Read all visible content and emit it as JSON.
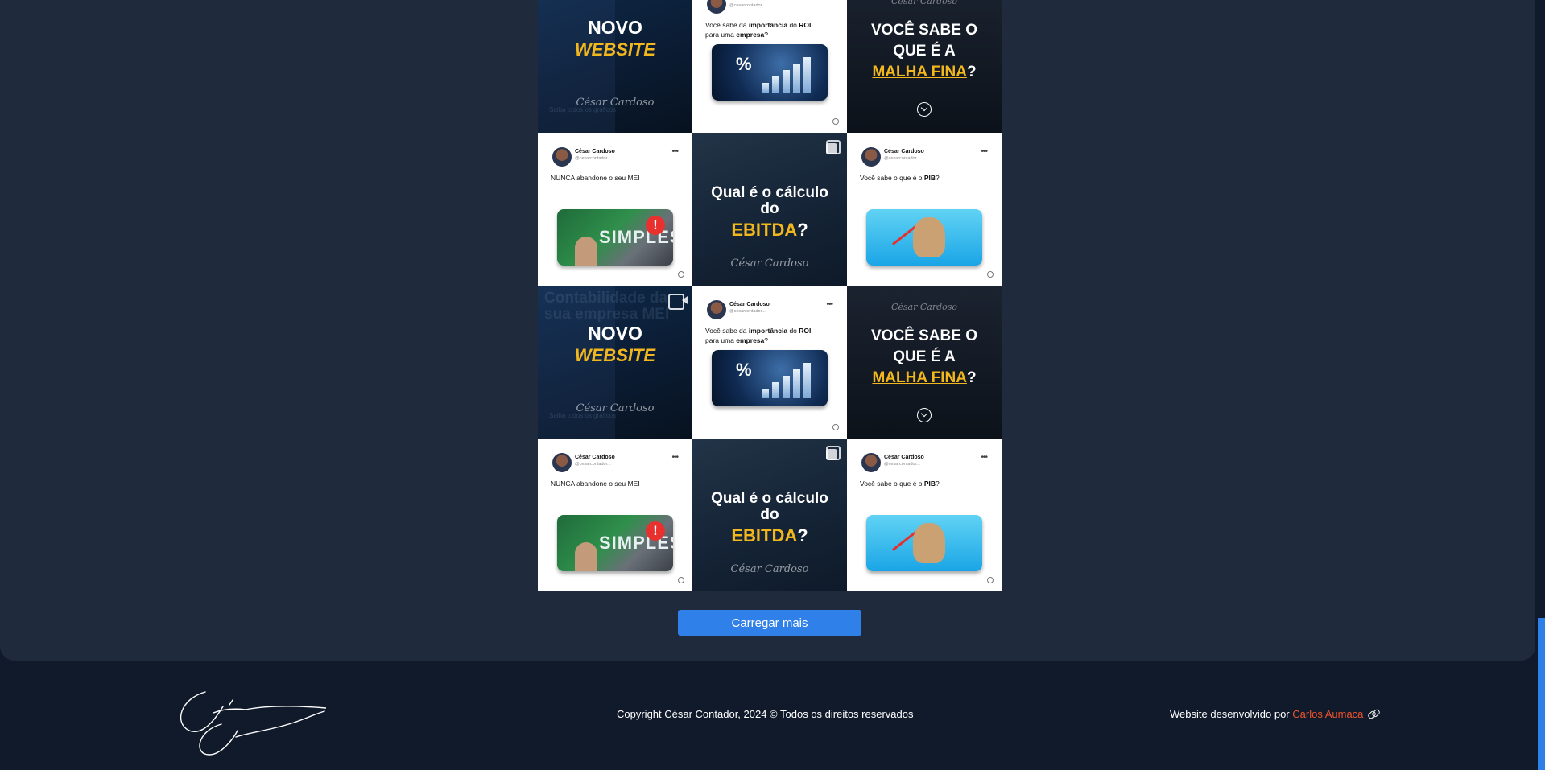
{
  "grid": {
    "website": {
      "faded": [
        "Contabilidade da",
        "sua empresa MEI"
      ],
      "line1": "NOVO",
      "line2": "WEBSITE",
      "signature": "César Cardoso",
      "tiny": "Saiba todos os gráficos"
    },
    "roi_tweet": {
      "name": "César Cardoso",
      "handle": "@cesarcontador...",
      "text_pre": "Você sabe da ",
      "text_b1": "importância",
      "text_mid": " do ",
      "text_b2": "ROI",
      "text_pre2": "para uma ",
      "text_b3": "empresa",
      "text_post": "?",
      "pct": "%"
    },
    "malha": {
      "signature": "César Cardoso",
      "line1": "VOCÊ SABE O",
      "line2": "QUE É A",
      "accent": "MALHA FINA",
      "mark": "?"
    },
    "mei_tweet": {
      "name": "César Cardoso",
      "handle": "@cesarcontador...",
      "text": "NUNCA abandone o seu MEI",
      "img_text": "SIMPLES",
      "excl": "!"
    },
    "ebitda": {
      "line1": "Qual é o cálculo",
      "line2": "do",
      "accent": "EBITDA",
      "mark": "?",
      "signature": "César Cardoso"
    },
    "pib_tweet": {
      "name": "César Cardoso",
      "handle": "@cesarcontador...",
      "text_pre": "Você sabe o que é o ",
      "text_b": "PIB",
      "text_post": "?"
    }
  },
  "load_more": {
    "label": "Carregar mais"
  },
  "footer": {
    "signature": "César Cardoso",
    "copyright": "Copyright César Contador, 2024 © Todos os direitos reservados",
    "credit_prefix": "Website desenvolvido por ",
    "credit_author": "Carlos Aumaca"
  },
  "colors": {
    "panel": "#1f2a3d",
    "footer_bg": "#111a2b",
    "accent_yellow": "#f2b71d",
    "button": "#2f80e8",
    "author": "#f0532b"
  }
}
